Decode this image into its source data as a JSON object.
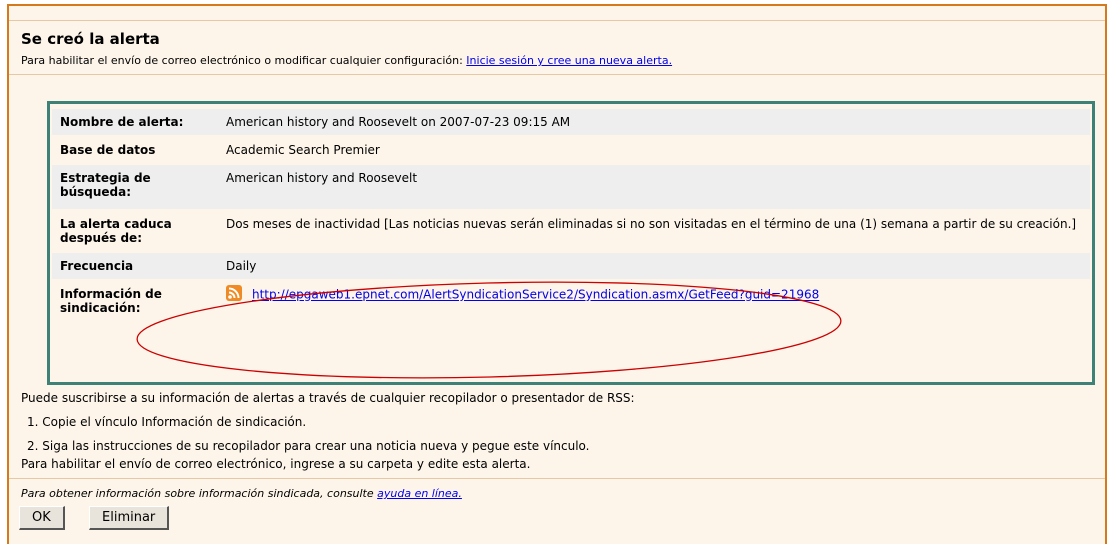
{
  "dialog": {
    "title": "Se creó la alerta",
    "subline_text": "Para habilitar el envío de correo electrónico o modificar cualquier configuración: ",
    "subline_link": "Inicie sesión y cree una nueva alerta."
  },
  "details": [
    {
      "label": "Nombre de alerta:",
      "value": "American history and Roosevelt on 2007-07-23 09:15 AM"
    },
    {
      "label": "Base de datos",
      "value": "Academic Search Premier"
    },
    {
      "label": "Estrategia de búsqueda:",
      "value": "American history and Roosevelt"
    },
    {
      "label": "La alerta caduca después de:",
      "value": "Dos meses de inactividad [Las noticias nuevas serán eliminadas si no son visitadas en el término de una (1) semana a partir de su creación.]"
    },
    {
      "label": "Frecuencia",
      "value": "Daily"
    },
    {
      "label": "Información de sindicación:",
      "value": "http://epgaweb1.epnet.com/AlertSyndicationService2/Syndication.asmx/GetFeed?guid=21968",
      "icon": "rss-icon"
    }
  ],
  "instructions": {
    "intro": "Puede suscribirse a su información de alertas a través de cualquier recopilador o presentador de RSS:",
    "step1": "1. Copie el vínculo Información de sindicación.",
    "step2": "2. Siga las instrucciones de su recopilador para crear una noticia nueva y pegue este vínculo.",
    "email_note": "Para habilitar el envío de correo electrónico, ingrese a su carpeta y edite esta alerta."
  },
  "help": {
    "text": "Para obtener información sobre información sindicada, consulte ",
    "link": "ayuda en línea."
  },
  "buttons": {
    "ok": "OK",
    "delete": "Eliminar"
  },
  "colors": {
    "dialog_border": "#d47a1c",
    "box_border": "#3d8177",
    "annotation": "#cc0000"
  }
}
